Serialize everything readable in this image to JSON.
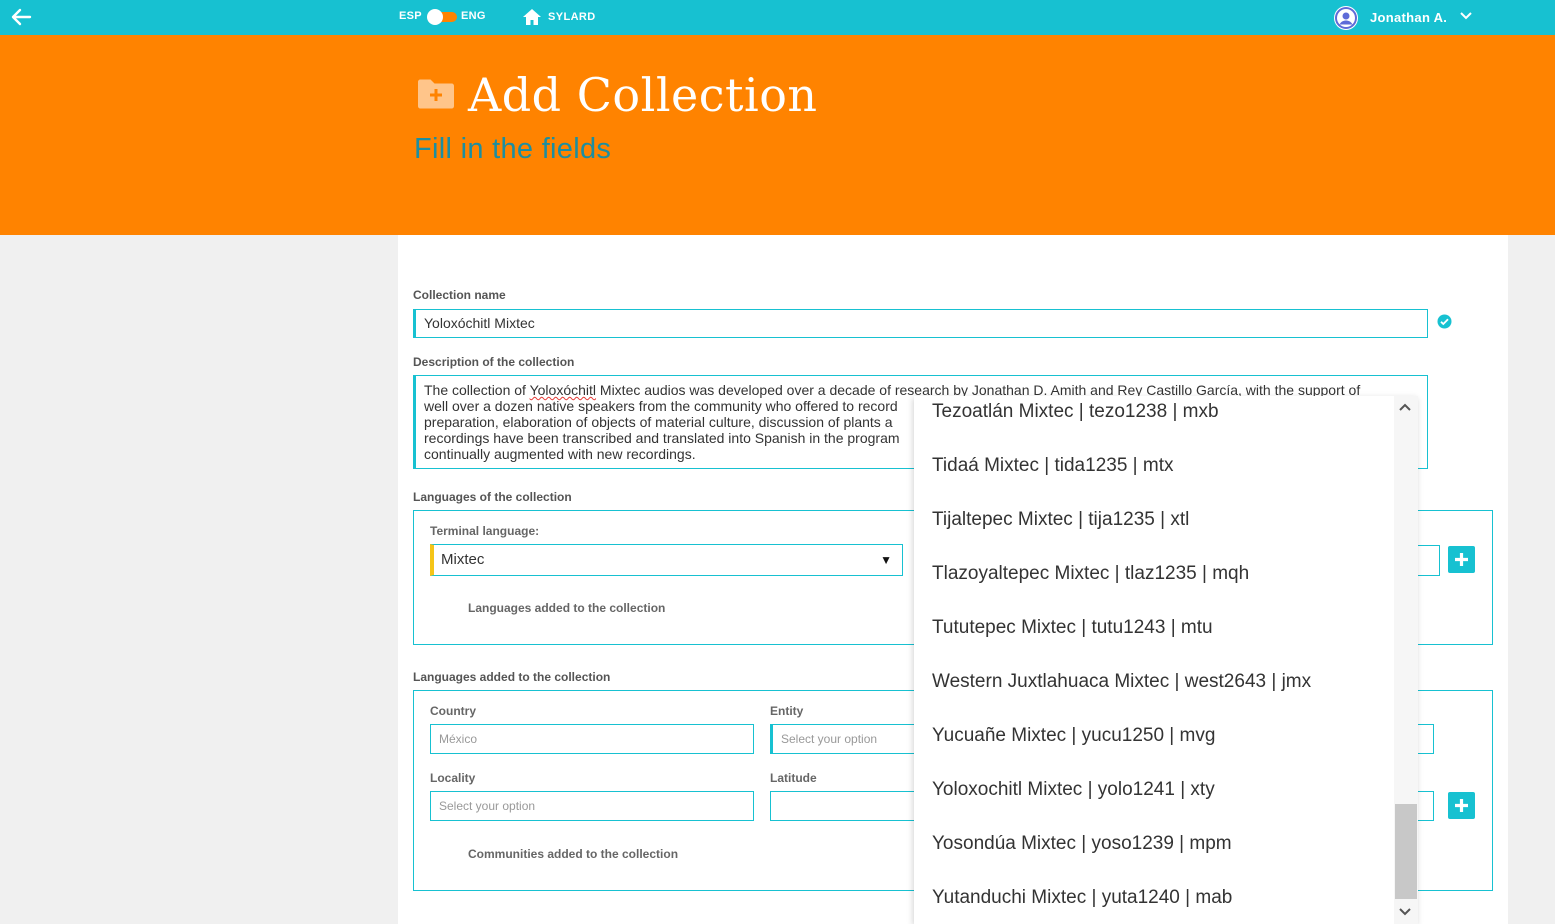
{
  "topbar": {
    "lang_left": "ESP",
    "lang_right": "ENG",
    "home_label": "SYLARD",
    "user_name": "Jonathan A."
  },
  "header": {
    "title": "Add Collection",
    "subtitle": "Fill in the fields"
  },
  "form": {
    "collection_name_label": "Collection name",
    "collection_name_value": "Yoloxóchitl Mixtec",
    "description_label": "Description of the collection",
    "description_lines": [
      {
        "pre": "The collection of ",
        "sq": "Yoloxóchitl",
        "post": " Mixtec audios was developed over a decade of research by Jonathan D. Amith and Rey Castillo García, with the support of"
      },
      {
        "pre": "well over a dozen native speakers from the community who offered to record",
        "sq": "",
        "post": ""
      },
      {
        "pre": "preparation, elaboration of objects of material culture, discussion of plants a",
        "sq": "",
        "post": ""
      },
      {
        "pre": "recordings have been transcribed and translated into Spanish in the program",
        "sq": "",
        "post": ""
      },
      {
        "pre": "continually augmented with new recordings.",
        "sq": "",
        "post": ""
      }
    ],
    "languages_label": "Languages of the collection",
    "terminal_language_label": "Terminal language:",
    "terminal_language_value": "Mixtec",
    "languages_added_inner": "Languages added to the collection",
    "languages_added_label": "Languages added to the collection",
    "country_label": "Country",
    "country_placeholder": "México",
    "entity_label": "Entity",
    "entity_placeholder": "Select your option",
    "locality_label": "Locality",
    "locality_placeholder": "Select your option",
    "latitude_label": "Latitude",
    "communities_added": "Communities added to the collection"
  },
  "dropdown": {
    "items": [
      "Tezoatlán Mixtec | tezo1238 | mxb",
      "Tidaá Mixtec | tida1235 | mtx",
      "Tijaltepec Mixtec | tija1235 | xtl",
      "Tlazoyaltepec Mixtec | tlaz1235 | mqh",
      "Tututepec Mixtec | tutu1243 | mtu",
      "Western Juxtlahuaca Mixtec | west2643 | jmx",
      "Yucuañe Mixtec | yucu1250 | mvg",
      "Yoloxochitl Mixtec | yolo1241 | xty",
      "Yosondúa Mixtec | yoso1239 | mpm",
      "Yutanduchi Mixtec | yuta1240 | mab"
    ]
  },
  "colors": {
    "topbar": "#17c1d1",
    "hero": "#ff8300",
    "subtitle": "#1c8ea0",
    "accent_yellow": "#f5c518"
  },
  "icons": [
    "back-arrow-icon",
    "home-icon",
    "user-avatar-icon",
    "chevron-down-icon",
    "folder-plus-icon",
    "check-circle-icon",
    "plus-icon",
    "dropdown-arrow-icon"
  ]
}
